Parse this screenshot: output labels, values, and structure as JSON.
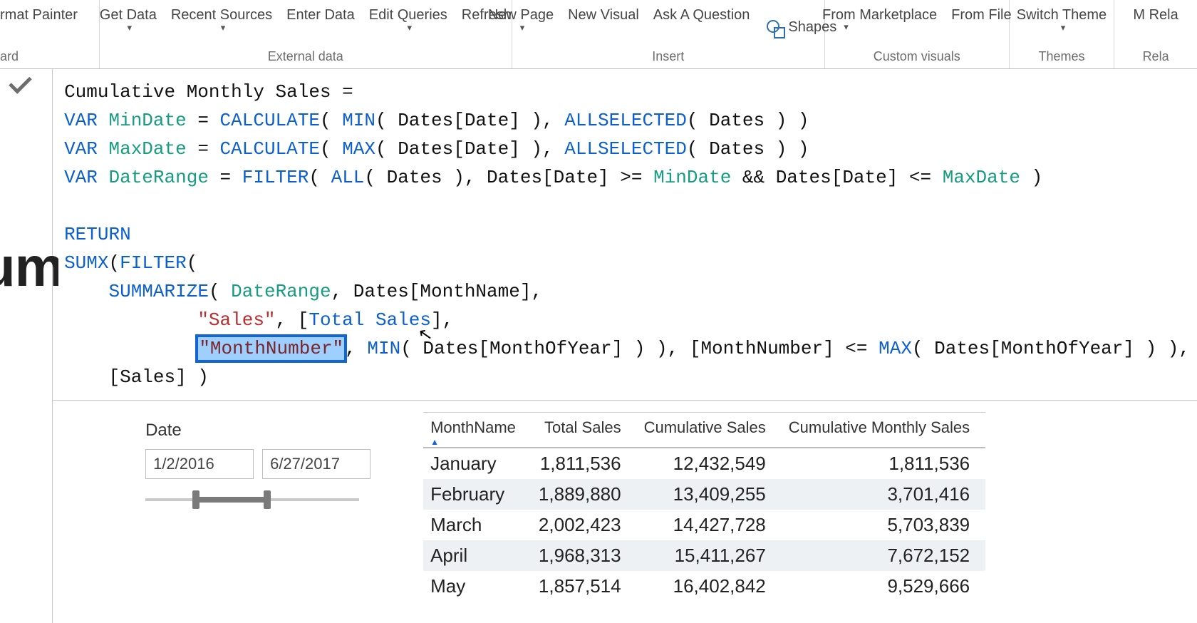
{
  "ribbon": {
    "clipboard": {
      "format_painter": "rmat Painter",
      "label": "ard"
    },
    "external_data": {
      "get_data": "Get\nData",
      "recent_sources": "Recent\nSources",
      "enter_data": "Enter\nData",
      "edit_queries": "Edit\nQueries",
      "refresh": "Refresh",
      "label": "External data"
    },
    "insert": {
      "new_page": "New\nPage",
      "new_visual": "New\nVisual",
      "ask": "Ask A\nQuestion",
      "shapes": "Shapes",
      "label": "Insert"
    },
    "custom_visuals": {
      "marketplace": "From\nMarketplace",
      "file": "From\nFile",
      "label": "Custom visuals"
    },
    "themes": {
      "switch_theme": "Switch\nTheme",
      "label": "Themes"
    },
    "relationships": {
      "rel": "M\nRela",
      "label": "Rela"
    }
  },
  "bigcut": "um",
  "formula": {
    "name": "Cumulative Monthly Sales = ",
    "allselected": "ALLSELECTED"
  },
  "slicer": {
    "title": "Date",
    "start": "1/2/2016",
    "end": "6/27/2017"
  },
  "table": {
    "columns": [
      "MonthName",
      "Total Sales",
      "Cumulative Sales",
      "Cumulative Monthly Sales"
    ],
    "rows": [
      [
        "January",
        "1,811,536",
        "12,432,549",
        "1,811,536"
      ],
      [
        "February",
        "1,889,880",
        "13,409,255",
        "3,701,416"
      ],
      [
        "March",
        "2,002,423",
        "14,427,728",
        "5,703,839"
      ],
      [
        "April",
        "1,968,313",
        "15,411,267",
        "7,672,152"
      ],
      [
        "May",
        "1,857,514",
        "16,402,842",
        "9,529,666"
      ]
    ]
  }
}
